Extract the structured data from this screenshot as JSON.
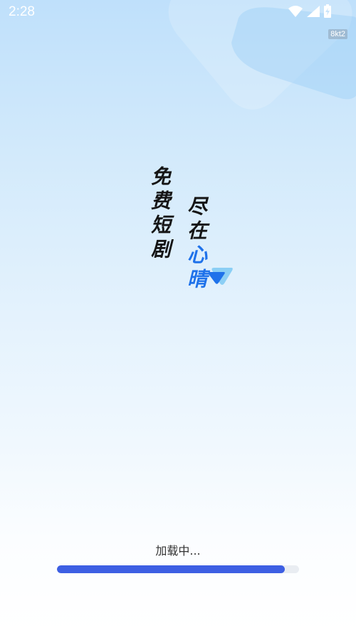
{
  "status_bar": {
    "time": "2:28",
    "icons": [
      "wifi-icon",
      "cellular-signal-icon",
      "battery-charging-icon"
    ]
  },
  "version_badge": "8kt2",
  "slogan": {
    "line1": "免费短剧",
    "line2_dark": "尽在",
    "line2_blue": "心晴",
    "accent_color": "#1f72ea"
  },
  "loading": {
    "text": "加载中...",
    "progress": 0.94,
    "bar_color": "#3d5fe3",
    "track_color": "#e9edf2"
  },
  "colors": {
    "background_top": "#bfe0fb",
    "background_bottom": "#ffffff"
  }
}
